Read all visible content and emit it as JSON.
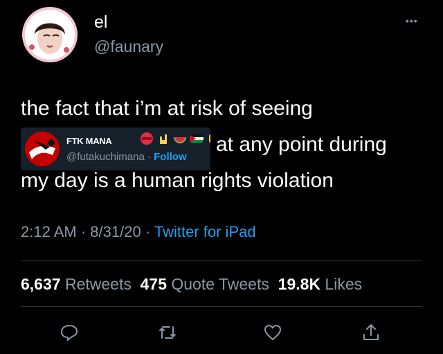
{
  "author": {
    "display_name": "el",
    "handle": "@faunary"
  },
  "tweet": {
    "line1": "the fact that i’m at risk of seeing",
    "line2": "at any point during",
    "line3": "my day is a human rights violation"
  },
  "embedded_account": {
    "name": "FTK MANA",
    "handle": "@futakuchimana",
    "separator": "·",
    "follow_label": "Follow",
    "emoji_icons": [
      "red-heart-icon",
      "rock-hand-icon",
      "watermelon-icon",
      "palestine-flag-icon",
      "raised-fist-icon"
    ]
  },
  "meta": {
    "time": "2:12 AM",
    "date": "8/31/20",
    "sep": "·",
    "source": "Twitter for iPad"
  },
  "stats": {
    "retweets_count": "6,637",
    "retweets_label": "Retweets",
    "quotes_count": "475",
    "quotes_label": "Quote Tweets",
    "likes_count": "19.8K",
    "likes_label": "Likes"
  },
  "colors": {
    "background": "#000000",
    "text": "#ffffff",
    "muted": "#8b98a5",
    "accent": "#1da1f2"
  }
}
